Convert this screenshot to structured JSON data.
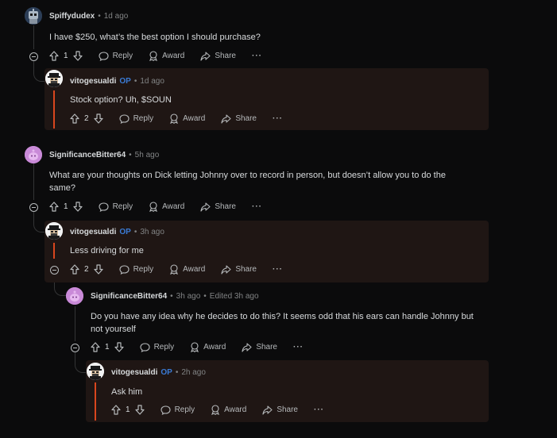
{
  "comments": [
    {
      "author": "Spiffydudex",
      "op": "",
      "time": "1d ago",
      "edited": "",
      "body": [
        "I have $250, what’s the best option I should purchase?"
      ],
      "votes": "1"
    },
    {
      "author": "vitogesualdi",
      "op": "OP",
      "time": "1d ago",
      "edited": "",
      "body": [
        "Stock option? Uh, $SOUN"
      ],
      "votes": "2"
    },
    {
      "author": "SignificanceBitter64",
      "op": "",
      "time": "5h ago",
      "edited": "",
      "body": [
        "What are your thoughts on Dick letting Johnny over to record in person, but doesn’t allow you to do the",
        "same?"
      ],
      "votes": "1"
    },
    {
      "author": "vitogesualdi",
      "op": "OP",
      "time": "3h ago",
      "edited": "",
      "body": [
        "Less driving for me"
      ],
      "votes": "2"
    },
    {
      "author": "SignificanceBitter64",
      "op": "",
      "time": "3h ago",
      "edited": "Edited 3h ago",
      "body": [
        "Do you have any idea why he decides to do this? It seems odd that his ears can handle Johnny but",
        "not yourself"
      ],
      "votes": "1"
    },
    {
      "author": "vitogesualdi",
      "op": "OP",
      "time": "2h ago",
      "edited": "",
      "body": [
        "Ask him"
      ],
      "votes": "1"
    }
  ],
  "actions": {
    "reply": "Reply",
    "award": "Award",
    "share": "Share",
    "more": "···",
    "separator": "•"
  },
  "icons": {
    "upvote": "arrow-up-icon",
    "downvote": "arrow-down-icon",
    "reply": "speech-bubble-icon",
    "award": "award-ribbon-icon",
    "share": "share-arrow-icon",
    "collapse": "collapse-minus-icon"
  },
  "colors": {
    "background": "#0b0b0c",
    "highlight_card": "#1f1614",
    "highlight_bar": "#d9461e",
    "op_badge": "#3a7bd5",
    "avatar_purple": "#c98ad8"
  }
}
